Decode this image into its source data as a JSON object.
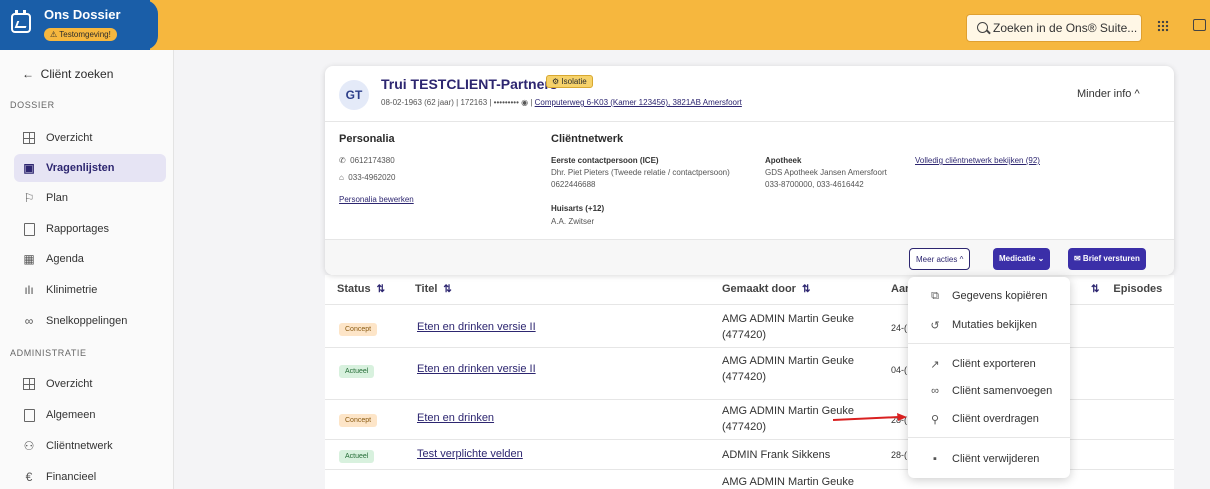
{
  "app": {
    "title": "Ons Dossier",
    "env_badge": "⚠ Testomgeving!"
  },
  "topbar": {
    "search_placeholder": "Zoeken in de Ons® Suite..."
  },
  "sidebar": {
    "back_label": "Cliënt zoeken",
    "section_dossier": "DOSSIER",
    "dossier_items": [
      {
        "label": "Overzicht",
        "icon": "grid-icon"
      },
      {
        "label": "Vragenlijsten",
        "icon": "questionnaire-icon"
      },
      {
        "label": "Plan",
        "icon": "plan-icon"
      },
      {
        "label": "Rapportages",
        "icon": "report-icon"
      },
      {
        "label": "Agenda",
        "icon": "calendar-icon"
      },
      {
        "label": "Klinimetrie",
        "icon": "chart-icon"
      },
      {
        "label": "Snelkoppelingen",
        "icon": "link-icon"
      }
    ],
    "section_admin": "ADMINISTRATIE",
    "admin_items": [
      {
        "label": "Overzicht",
        "icon": "grid-icon"
      },
      {
        "label": "Algemeen",
        "icon": "id-card-icon"
      },
      {
        "label": "Cliëntnetwerk",
        "icon": "network-icon"
      },
      {
        "label": "Financieel",
        "icon": "euro-icon"
      }
    ]
  },
  "client": {
    "initials": "GT",
    "name": "Trui TESTCLIENT-Partners",
    "isolation_badge": "⚙ Isolatie",
    "meta": "08-02-1963 (62 jaar) | 172163 | •••••••••",
    "address": "Computerweg 6-K03 (Kamer 123456), 3821AB Amersfoort",
    "less_info": "Minder info ^"
  },
  "personalia": {
    "title": "Personalia",
    "phone1": "0612174380",
    "phone2": "033-4962020",
    "edit_link": "Personalia bewerken"
  },
  "network": {
    "title": "Cliëntnetwerk",
    "ice_label": "Eerste contactpersoon (ICE)",
    "ice_name": "Dhr. Piet Pieters (Tweede relatie / contactpersoon)",
    "ice_phone": "0622446688",
    "gp_label": "Huisarts (+12)",
    "gp_name": "A.A. Zwitser",
    "pharmacy_label": "Apotheek",
    "pharmacy_name": "GDS Apotheek Jansen Amersfoort",
    "pharmacy_phone": "033-8700000, 033-4616442",
    "full_link": "Volledig cliëntnetwerk bekijken (92)"
  },
  "actions": {
    "more": "Meer acties ^",
    "medication": "Medicatie ⌄",
    "letter": "✉ Brief versturen"
  },
  "table": {
    "headers": {
      "status": "Status",
      "title": "Titel",
      "created_by": "Gemaakt door",
      "date": "Aar",
      "episodes": "Episodes"
    },
    "rows": [
      {
        "status": "Concept",
        "title": "Eten en drinken versie II",
        "creator": "AMG ADMIN Martin Geuke",
        "creator2": "(477420)",
        "date": "24-("
      },
      {
        "status": "Actueel",
        "title": "Eten en drinken versie II",
        "creator": "AMG ADMIN Martin Geuke",
        "creator2": "(477420)",
        "date": "04-("
      },
      {
        "status": "Concept",
        "title": "Eten en drinken",
        "creator": "AMG ADMIN Martin Geuke",
        "creator2": "(477420)",
        "date": "28-("
      },
      {
        "status": "Actueel",
        "title": "Test verplichte velden",
        "creator": "ADMIN Frank Sikkens",
        "creator2": "",
        "date": "28-("
      },
      {
        "status": "",
        "title": "",
        "creator": "AMG ADMIN Martin Geuke",
        "creator2": "",
        "date": ""
      }
    ]
  },
  "menu": {
    "items": [
      {
        "label": "Gegevens kopiëren",
        "icon": "copy-icon"
      },
      {
        "label": "Mutaties bekijken",
        "icon": "history-icon"
      },
      {
        "label": "Cliënt exporteren",
        "icon": "export-icon"
      },
      {
        "label": "Cliënt samenvoegen",
        "icon": "merge-icon"
      },
      {
        "label": "Cliënt overdragen",
        "icon": "transfer-user-icon"
      },
      {
        "label": "Cliënt verwijderen",
        "icon": "trash-icon"
      }
    ]
  },
  "colors": {
    "brand": "#1a5ea8",
    "topbar": "#f6b73e",
    "accent": "#3b2fa8",
    "annotation": "#d92020"
  }
}
